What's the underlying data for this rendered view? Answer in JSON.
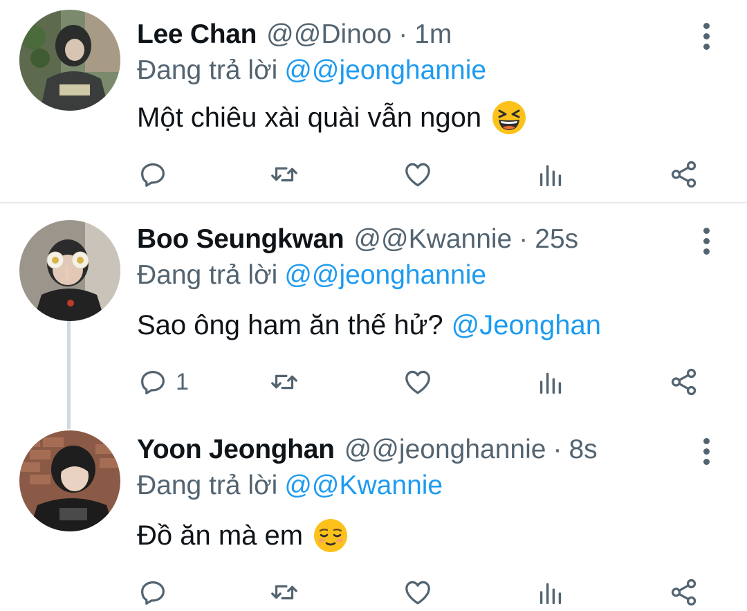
{
  "tweets": [
    {
      "name": "Lee Chan",
      "handle": "@@Dinoo",
      "separator": "·",
      "time": "1m",
      "replying_label": "Đang trả lời",
      "replying_to": "@@jeonghannie",
      "text": "Một chiêu xài quài vẫn ngon",
      "link": "",
      "emoji": "grinning-squinting-face-emoji",
      "reply_count": ""
    },
    {
      "name": "Boo Seungkwan",
      "handle": "@@Kwannie",
      "separator": "·",
      "time": "25s",
      "replying_label": "Đang trả lời",
      "replying_to": "@@jeonghannie",
      "text": "Sao ông ham ăn thế hử?",
      "link": "@Jeonghan",
      "emoji": "",
      "reply_count": "1"
    },
    {
      "name": "Yoon Jeonghan",
      "handle": "@@jeonghannie",
      "separator": "·",
      "time": "8s",
      "replying_label": "Đang trả lời",
      "replying_to": "@@Kwannie",
      "text": "Đồ ăn mà em",
      "link": "",
      "emoji": "relieved-face-emoji",
      "reply_count": ""
    }
  ],
  "icons": {
    "reply": "reply-icon",
    "retweet": "retweet-icon",
    "like": "heart-icon",
    "views": "analytics-icon",
    "share": "share-icon",
    "more": "more-vertical-icon"
  },
  "colors": {
    "link": "#1d9bf0",
    "secondary_text": "#536471",
    "primary_text": "#0f1419",
    "divider": "#e6e9ec",
    "thread_line": "#cfd9de"
  }
}
